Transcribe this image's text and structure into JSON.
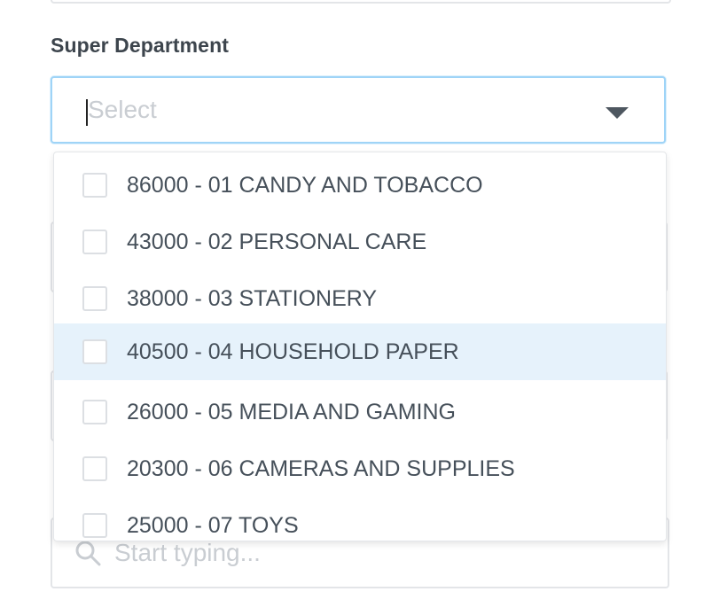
{
  "form": {
    "super_department": {
      "label": "Super Department",
      "placeholder": "Select"
    },
    "search": {
      "placeholder": "Start typing..."
    }
  },
  "dropdown": {
    "options": [
      {
        "label": "86000 - 01 CANDY AND TOBACCO",
        "checked": false,
        "highlighted": false
      },
      {
        "label": "43000 - 02 PERSONAL CARE",
        "checked": false,
        "highlighted": false
      },
      {
        "label": "38000 - 03 STATIONERY",
        "checked": false,
        "highlighted": false
      },
      {
        "label": "40500 - 04 HOUSEHOLD PAPER",
        "checked": false,
        "highlighted": true
      },
      {
        "label": "26000 - 05 MEDIA AND GAMING",
        "checked": false,
        "highlighted": false
      },
      {
        "label": "20300 - 06 CAMERAS AND SUPPLIES",
        "checked": false,
        "highlighted": false
      },
      {
        "label": "25000 - 07 TOYS",
        "checked": false,
        "highlighted": false
      }
    ]
  },
  "colors": {
    "focus_border": "#9fd4f7",
    "highlight_row": "#e6f2fb",
    "text": "#46505a",
    "placeholder": "#c9cdd2"
  },
  "icons": {
    "dropdown": "chevron-down-icon",
    "search": "search-icon"
  }
}
